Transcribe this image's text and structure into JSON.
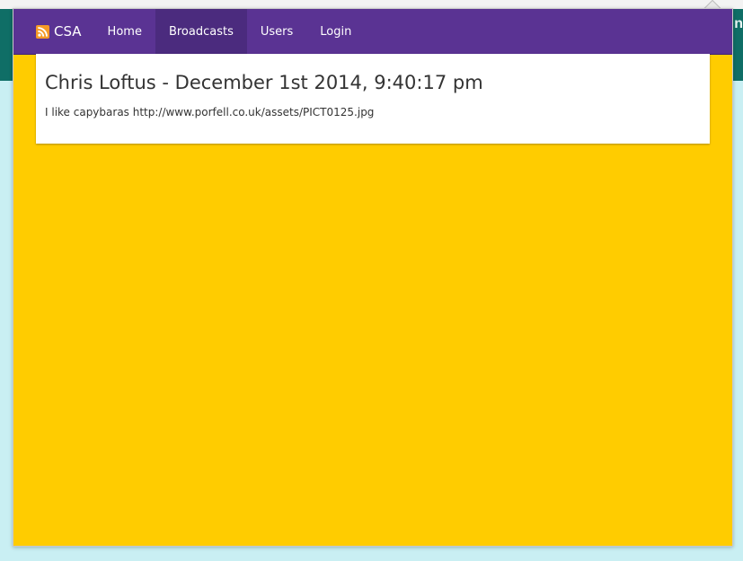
{
  "background": {
    "header_partial_text": "n",
    "colors": {
      "teal": "#0f6e66",
      "light_cyan": "#c9eff3"
    }
  },
  "navbar": {
    "brand_icon": "rss-icon",
    "brand_label": "CSA",
    "items": [
      {
        "label": "Home",
        "active": false
      },
      {
        "label": "Broadcasts",
        "active": true
      },
      {
        "label": "Users",
        "active": false
      },
      {
        "label": "Login",
        "active": false
      }
    ],
    "colors": {
      "background": "#5a3393",
      "active_background": "#4b2b7e",
      "text": "#ffffff"
    }
  },
  "main": {
    "background_color": "#ffcc00",
    "broadcast": {
      "title": "Chris Loftus - December 1st 2014, 9:40:17 pm",
      "message": "I like capybaras http://www.porfell.co.uk/assets/PICT0125.jpg"
    }
  }
}
